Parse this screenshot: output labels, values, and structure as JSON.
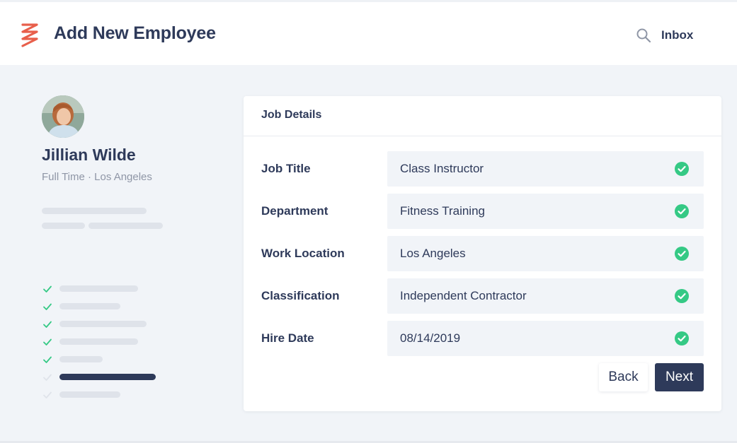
{
  "colors": {
    "brand": "#e85f4b",
    "navy": "#2e3a5a",
    "muted": "#8f96a6",
    "success": "#35c985",
    "skeleton": "#dfe3ea",
    "background": "#f1f4f8"
  },
  "header": {
    "logo_icon": "brand-zigzag-logo",
    "title": "Add New Employee",
    "search_icon": "search-icon",
    "inbox_label": "Inbox"
  },
  "profile": {
    "name": "Jillian Wilde",
    "meta": "Full Time · Los Angeles",
    "avatar_icon": "avatar-photo"
  },
  "steps": [
    {
      "state": "done"
    },
    {
      "state": "done"
    },
    {
      "state": "done"
    },
    {
      "state": "done"
    },
    {
      "state": "done"
    },
    {
      "state": "current"
    },
    {
      "state": "pending"
    }
  ],
  "card": {
    "title": "Job Details",
    "rows": [
      {
        "label": "Job Title",
        "value": "Class Instructor",
        "valid": true
      },
      {
        "label": "Department",
        "value": "Fitness Training",
        "valid": true
      },
      {
        "label": "Work Location",
        "value": "Los Angeles",
        "valid": true
      },
      {
        "label": "Classification",
        "value": "Independent Contractor",
        "valid": true
      },
      {
        "label": "Hire Date",
        "value": "08/14/2019",
        "valid": true
      }
    ],
    "back_label": "Back",
    "next_label": "Next"
  }
}
